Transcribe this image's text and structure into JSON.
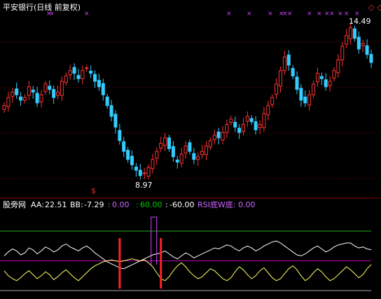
{
  "header": {
    "title": "平安银行(日线 前复权)",
    "title_color": "#ffffff"
  },
  "price_panel": {
    "high_label": "14.49",
    "low_label": "8.97",
    "dollar_marker": "$",
    "diamond_icons": "◇ ◇",
    "x_marker_positions_note": "magenta x marks across top row"
  },
  "indicator_panel": {
    "name": "股旁网",
    "items": [
      {
        "label": "AA:",
        "value": "22.51",
        "color": "#ffffff"
      },
      {
        "label": "BB:",
        "value": "-7.29",
        "color": "#ffffff"
      },
      {
        "label": ":",
        "value": "0.00",
        "color": "#cc66ff"
      },
      {
        "label": ":",
        "value": "60.00",
        "color": "#00cc00"
      },
      {
        "label": ":",
        "value": "-60.00",
        "color": "#ffffff"
      },
      {
        "label": "RSI底W底:",
        "value": "0.00",
        "color": "#cc66ff"
      }
    ]
  },
  "watermark": "股旁网",
  "colors": {
    "up": "#ff3333",
    "down": "#33ccff",
    "grid": "#8b0000",
    "line60": "#22aa22",
    "line0": "#b000b0",
    "lineNeg": "#aaaaaa",
    "aa_line": "#ffffff",
    "bb_line": "#ffff66",
    "signal": "#ff2222"
  },
  "chart_data": {
    "type": "candlestick",
    "title": "平安银行(日线 前复权)",
    "price_annotations": {
      "high": 14.49,
      "low": 8.97
    },
    "price_range": [
      8.5,
      15.0
    ],
    "closes": [
      11.6,
      11.9,
      12.1,
      12.0,
      11.8,
      11.9,
      12.3,
      12.1,
      11.7,
      12.0,
      12.4,
      12.2,
      11.9,
      12.1,
      12.5,
      12.7,
      12.9,
      12.8,
      12.6,
      12.9,
      13.0,
      12.8,
      12.5,
      12.3,
      12.0,
      11.6,
      11.2,
      10.8,
      10.3,
      9.9,
      9.6,
      9.4,
      9.2,
      9.0,
      9.1,
      9.3,
      9.6,
      9.9,
      10.2,
      10.4,
      10.0,
      9.7,
      9.5,
      9.8,
      10.1,
      9.9,
      9.6,
      9.7,
      9.9,
      10.1,
      10.3,
      10.5,
      10.4,
      10.6,
      10.9,
      11.1,
      10.8,
      10.6,
      10.9,
      11.2,
      11.0,
      10.7,
      10.9,
      11.3,
      11.6,
      11.9,
      12.4,
      12.9,
      13.4,
      13.1,
      12.7,
      12.2,
      11.8,
      11.7,
      12.0,
      12.4,
      12.8,
      12.6,
      12.3,
      12.5,
      12.9,
      13.3,
      13.8,
      14.2,
      14.49,
      14.1,
      13.7,
      13.9,
      13.5,
      13.2
    ],
    "aa_range": [
      -60,
      60
    ],
    "aa": [
      10,
      18,
      24,
      20,
      12,
      16,
      26,
      22,
      14,
      20,
      28,
      24,
      18,
      22,
      30,
      34,
      28,
      24,
      20,
      26,
      30,
      24,
      16,
      10,
      4,
      -2,
      -6,
      -10,
      -14,
      -16,
      -12,
      -8,
      -4,
      0,
      4,
      8,
      12,
      14,
      16,
      20,
      14,
      8,
      4,
      10,
      16,
      12,
      6,
      10,
      14,
      18,
      22,
      26,
      24,
      28,
      32,
      30,
      24,
      20,
      26,
      30,
      26,
      20,
      24,
      30,
      34,
      38,
      40,
      36,
      30,
      24,
      18,
      12,
      10,
      14,
      20,
      26,
      30,
      24,
      18,
      22,
      28,
      32,
      34,
      36,
      36,
      30,
      26,
      28,
      24,
      22.51
    ],
    "bb": [
      -20,
      -30,
      -36,
      -40,
      -34,
      -26,
      -20,
      -28,
      -36,
      -30,
      -22,
      -28,
      -38,
      -32,
      -24,
      -18,
      -26,
      -34,
      -40,
      -32,
      -24,
      -16,
      -10,
      -6,
      -2,
      0,
      2,
      0,
      -2,
      0,
      2,
      4,
      2,
      0,
      2,
      -4,
      -12,
      -24,
      -36,
      -40,
      -32,
      -20,
      -10,
      -4,
      -12,
      -22,
      -30,
      -36,
      -32,
      -24,
      -16,
      -20,
      -28,
      -36,
      -40,
      -34,
      -22,
      -12,
      -18,
      -28,
      -36,
      -30,
      -20,
      -14,
      -24,
      -34,
      -40,
      -36,
      -26,
      -16,
      -10,
      -18,
      -30,
      -40,
      -34,
      -24,
      -16,
      -22,
      -32,
      -40,
      -36,
      -28,
      -20,
      -12,
      -18,
      -26,
      -34,
      -28,
      -16,
      -7.29
    ],
    "signals": [
      28,
      38
    ]
  }
}
